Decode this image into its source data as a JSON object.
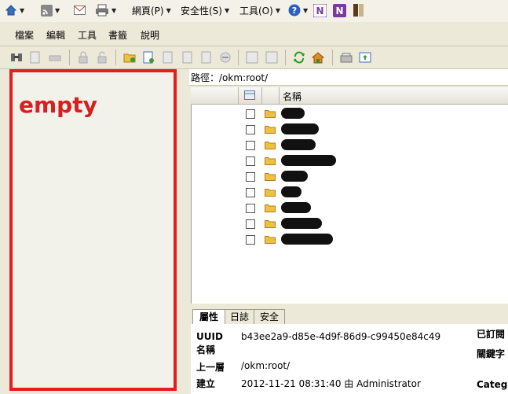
{
  "ie_toolbar": {
    "page_menu": "網頁(P)",
    "security_menu": "安全性(S)",
    "tools_menu": "工具(O)"
  },
  "app_menu": {
    "items": [
      "檔案",
      "編輯",
      "工具",
      "書籤",
      "說明"
    ]
  },
  "left_panel": {
    "annotation": "empty"
  },
  "path": {
    "label": "路徑：/okm:root/"
  },
  "grid": {
    "name_header": "名稱",
    "row_count": 9
  },
  "tabs": [
    "屬性",
    "日誌",
    "安全"
  ],
  "properties": {
    "uuid_label": "UUID",
    "uuid_value": "b43ee2a9-d85e-4d9f-86d9-c99450e84c49",
    "name_label": "名稱",
    "parent_label": "上一層",
    "parent_value": "/okm:root/",
    "created_label": "建立",
    "created_value": "2012-11-21 08:31:40 由 Administrator",
    "right_label_1": "已訂閱",
    "right_label_2": "關鍵字",
    "right_label_3": "Categ"
  },
  "colors": {
    "annotation_red": "#e02020",
    "folder_yellow": "#f0c040"
  }
}
